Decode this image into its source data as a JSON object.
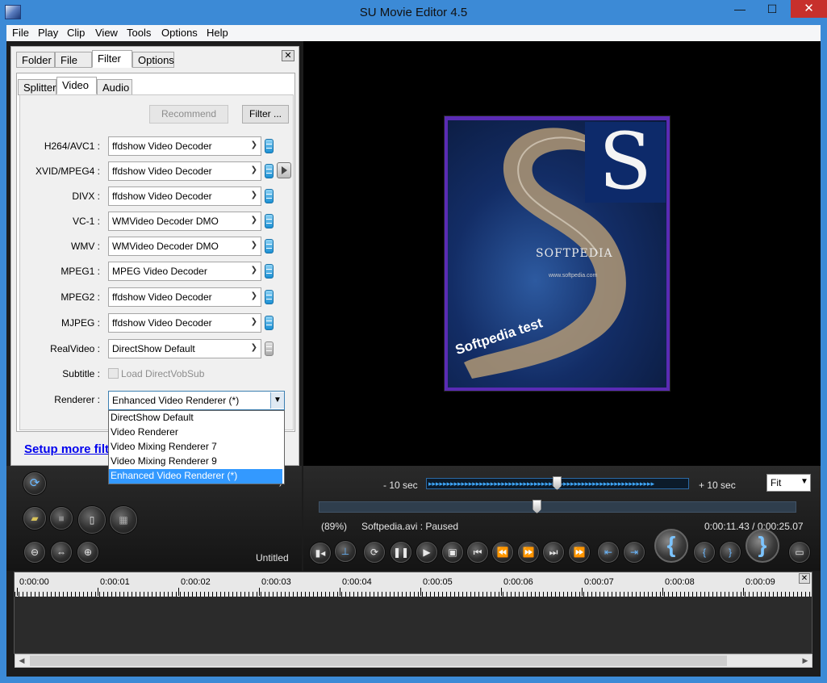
{
  "window": {
    "title": "SU Movie Editor 4.5",
    "minimize": "—",
    "maximize": "☐",
    "close": "✕"
  },
  "menu": [
    "File",
    "Play",
    "Clip",
    "View",
    "Tools",
    "Options",
    "Help"
  ],
  "panel": {
    "tabs": [
      "Folder",
      "File",
      "Filter",
      "Options"
    ],
    "active_tab": "Filter",
    "subtabs": [
      "Splitter",
      "Video",
      "Audio"
    ],
    "active_subtab": "Video",
    "recommend_label": "Recommend",
    "filter_label": "Filter ...",
    "rows": [
      {
        "label": "H264/AVC1 :",
        "value": "ffdshow Video Decoder"
      },
      {
        "label": "XVID/MPEG4 :",
        "value": "ffdshow Video Decoder"
      },
      {
        "label": "DIVX :",
        "value": "ffdshow Video Decoder"
      },
      {
        "label": "VC-1 :",
        "value": "WMVideo Decoder DMO"
      },
      {
        "label": "WMV :",
        "value": "WMVideo Decoder DMO"
      },
      {
        "label": "MPEG1 :",
        "value": "MPEG Video Decoder"
      },
      {
        "label": "MPEG2 :",
        "value": "ffdshow Video Decoder"
      },
      {
        "label": "MJPEG :",
        "value": "ffdshow Video Decoder"
      },
      {
        "label": "RealVideo :",
        "value": "DirectShow Default"
      }
    ],
    "subtitle_label": "Subtitle :",
    "subtitle_checkbox": "Load DirectVobSub",
    "renderer_label": "Renderer :",
    "renderer_value": "Enhanced Video Renderer (*)",
    "renderer_options": [
      "DirectShow Default",
      "Video Renderer",
      "Video Mixing Renderer 7",
      "Video Mixing Renderer 9",
      "Enhanced Video Renderer (*)"
    ],
    "setup_link": "Setup more filt"
  },
  "video": {
    "brand": "SOFTPEDIA",
    "url": "www.softpedia.com",
    "watermark": "Softpedia test",
    "logo_letter": "S"
  },
  "controls": {
    "minus_10": "- 10 sec",
    "plus_10": "+ 10 sec",
    "zoom_select": "Fit",
    "zoom_percent": "(89%)",
    "status": "Softpedia.avi : Paused",
    "time": "0:00:11.43 / 0:00:25.07",
    "project_name": "Untitled",
    "hidden_paren": ")",
    "jog_arrows": "▸▸▸▸▸▸▸▸▸▸▸▸▸▸▸▸▸▸▸▸▸▸▸▸▸▸▸▸▸▸▸▸▸▸▸▸▸▸▸▸▸▸▸▸▸▸▸▸▸▸▸▸▸▸▸▸▸▸▸▸▸▸"
  },
  "timeline": {
    "ticks": [
      "0:00:00",
      "0:00:01",
      "0:00:02",
      "0:00:03",
      "0:00:04",
      "0:00:05",
      "0:00:06",
      "0:00:07",
      "0:00:08",
      "0:00:09"
    ]
  }
}
